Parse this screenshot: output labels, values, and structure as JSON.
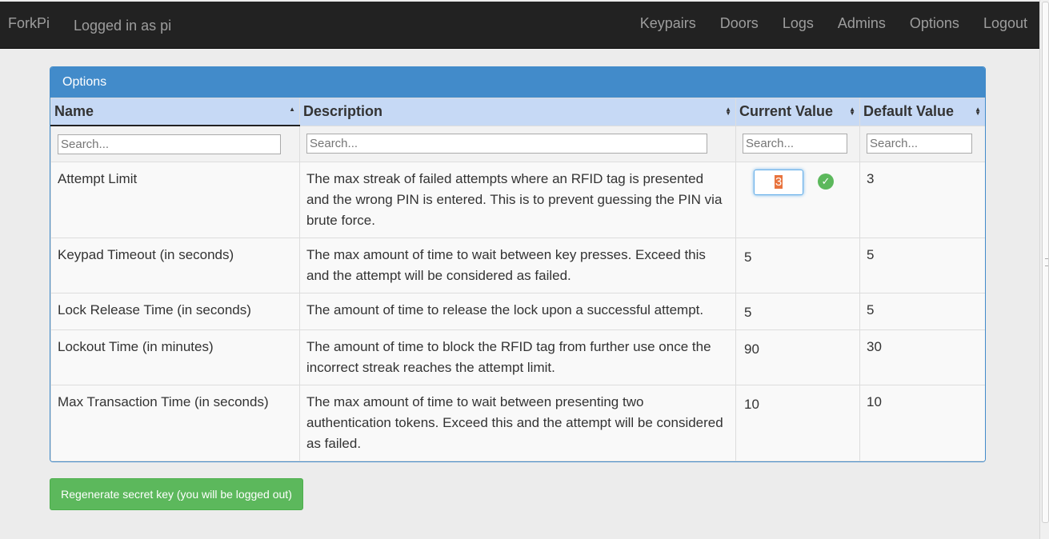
{
  "navbar": {
    "brand": "ForkPi",
    "logged_in": "Logged in as pi",
    "links": [
      "Keypairs",
      "Doors",
      "Logs",
      "Admins",
      "Options",
      "Logout"
    ]
  },
  "panel": {
    "title": "Options"
  },
  "table": {
    "columns": [
      "Name",
      "Description",
      "Current Value",
      "Default Value"
    ],
    "search_placeholder": "Search...",
    "rows": [
      {
        "name": "Attempt Limit",
        "description": "The max streak of failed attempts where an RFID tag is presented and the wrong PIN is entered. This is to prevent guessing the PIN via brute force.",
        "current": "3",
        "default": "3"
      },
      {
        "name": "Keypad Timeout (in seconds)",
        "description": "The max amount of time to wait between key presses. Exceed this and the attempt will be considered as failed.",
        "current": "5",
        "default": "5"
      },
      {
        "name": "Lock Release Time (in seconds)",
        "description": "The amount of time to release the lock upon a successful attempt.",
        "current": "5",
        "default": "5"
      },
      {
        "name": "Lockout Time (in minutes)",
        "description": "The amount of time to block the RFID tag from further use once the incorrect streak reaches the attempt limit.",
        "current": "90",
        "default": "30"
      },
      {
        "name": "Max Transaction Time (in seconds)",
        "description": "The max amount of time to wait between presenting two authentication tokens. Exceed this and the attempt will be considered as failed.",
        "current": "10",
        "default": "10"
      }
    ]
  },
  "regen_button": "Regenerate secret key (you will be logged out)",
  "icons": {
    "confirm": "check-circle-icon",
    "sort": "sort-icon"
  },
  "colors": {
    "navbar": "#222222",
    "panel": "#428bca",
    "header": "#c6d9f5",
    "button": "#5cb85c"
  }
}
